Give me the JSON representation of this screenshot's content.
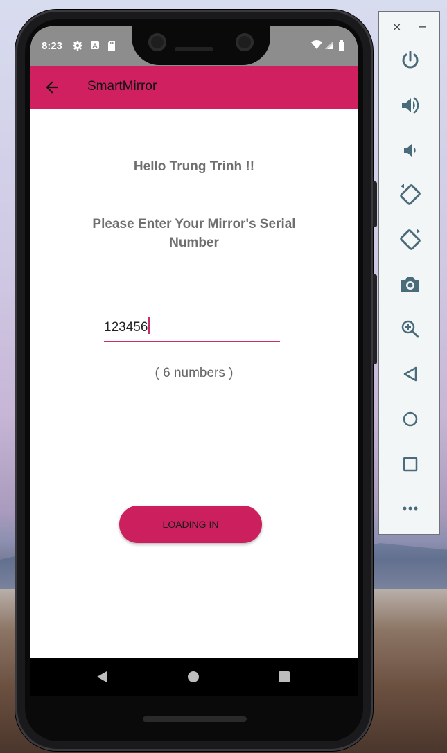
{
  "status_bar": {
    "time": "8:23"
  },
  "app_bar": {
    "title": "SmartMirror"
  },
  "main": {
    "greeting": "Hello Trung Trinh !!",
    "prompt": "Please Enter Your Mirror's Serial Number",
    "serial_input_value": "123456",
    "hint": "( 6 numbers )",
    "submit_label": "LOADING IN"
  },
  "emulator_panel": {
    "close_label": "×",
    "minimize_label": "−",
    "tools": [
      "power-icon",
      "volume-up-icon",
      "volume-down-icon",
      "rotate-left-icon",
      "rotate-right-icon",
      "camera-icon",
      "zoom-icon",
      "back-icon",
      "home-icon",
      "overview-icon",
      "more-icon"
    ]
  },
  "colors": {
    "accent": "#d0205f",
    "status_bar": "#8d8d8d",
    "text_gray": "#6f6f6f"
  }
}
